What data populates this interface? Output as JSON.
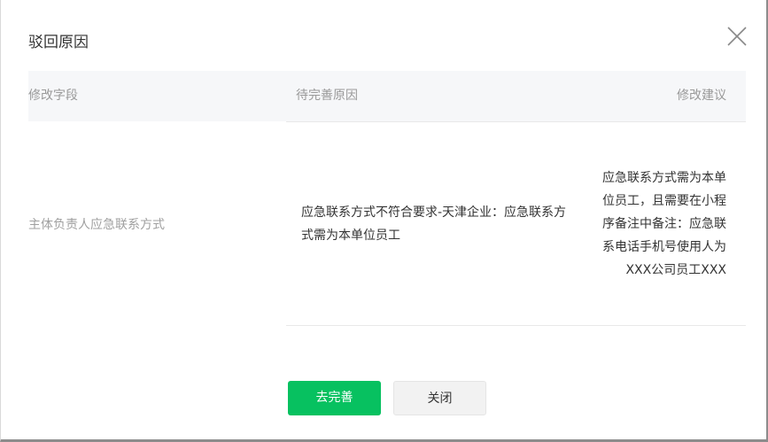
{
  "dialog": {
    "title": "驳回原因"
  },
  "table": {
    "headers": {
      "field": "修改字段",
      "reason": "待完善原因",
      "suggestion": "修改建议"
    },
    "rows": [
      {
        "field": "主体负责人应急联系方式",
        "reason": "应急联系方式不符合要求-天津企业：应急联系方式需为本单位员工",
        "suggestion": "应急联系方式需为本单位员工，且需要在小程序备注中备注：应急联系电话手机号使用人为XXX公司员工XXX"
      }
    ]
  },
  "footer": {
    "primary_label": "去完善",
    "secondary_label": "关闭"
  },
  "colors": {
    "primary": "#07c160",
    "header_bg": "#f6f7f9"
  }
}
